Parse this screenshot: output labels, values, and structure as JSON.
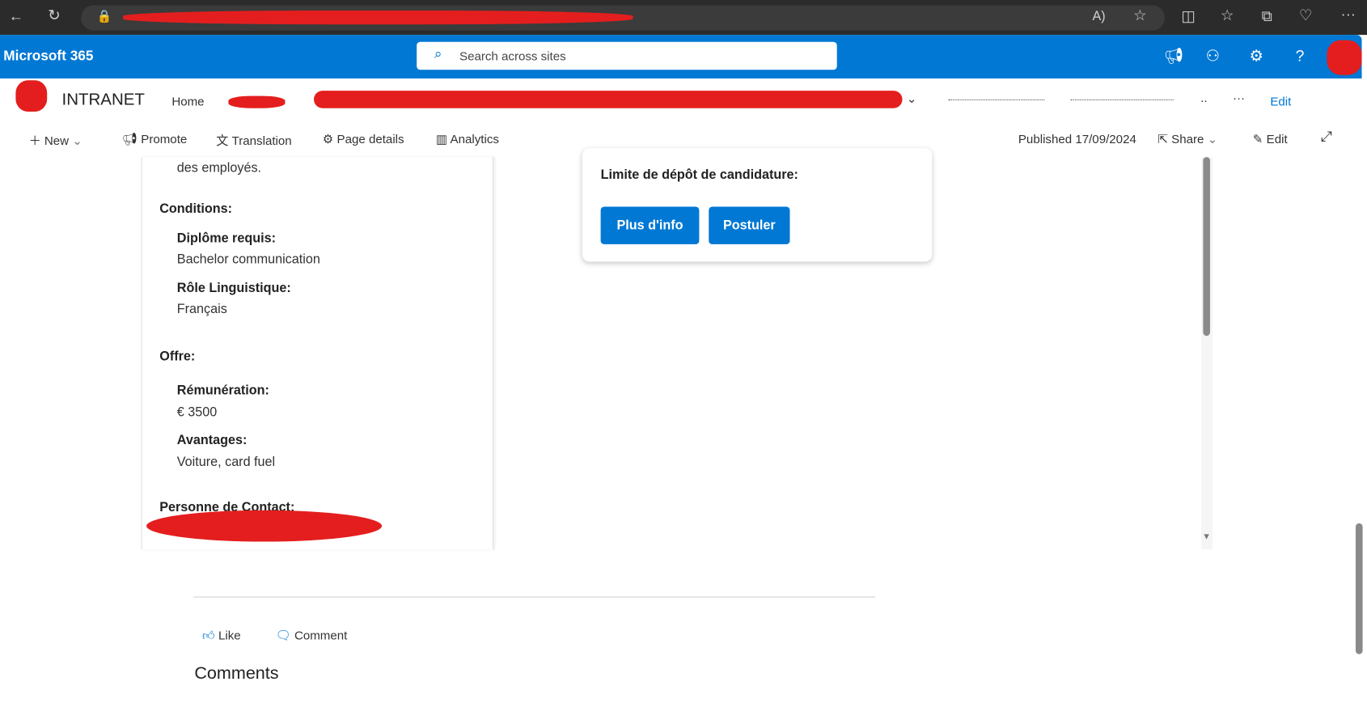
{
  "browser": {
    "icons": [
      "back-icon",
      "refresh-icon",
      "lock-icon",
      "read-aloud-icon",
      "favorite-icon",
      "split-screen-icon",
      "favorites-icon",
      "collections-icon",
      "health-icon",
      "more-icon"
    ]
  },
  "m365": {
    "title": "Microsoft 365",
    "search_placeholder": "Search across sites"
  },
  "site": {
    "name": "INTRANET",
    "nav": [
      "Home"
    ],
    "more": "···",
    "edit": "Edit"
  },
  "commandbar": {
    "new": "New",
    "promote": "Promote",
    "translation": "Translation",
    "page_details": "Page details",
    "analytics": "Analytics",
    "published": "Published 17/09/2024",
    "share": "Share",
    "edit": "Edit"
  },
  "left": {
    "top_text": "des employés.",
    "conditions": "Conditions:",
    "diploma_label": "Diplôme requis:",
    "diploma_value": "Bachelor communication",
    "language_label": "Rôle Linguistique:",
    "language_value": "Français",
    "offer": "Offre:",
    "salary_label": "Rémunération:",
    "salary_value": "€ 3500",
    "benefits_label": "Avantages:",
    "benefits_value": "Voiture, card fuel",
    "contact": "Personne de Contact:"
  },
  "card": {
    "deadline": "Limite de dépôt de candidature:",
    "more_info": "Plus d'info",
    "apply": "Postuler"
  },
  "footer": {
    "like": "Like",
    "comment": "Comment",
    "comments_heading": "Comments"
  },
  "colors": {
    "brand": "#0078d4",
    "redaction": "#e41e1e"
  }
}
